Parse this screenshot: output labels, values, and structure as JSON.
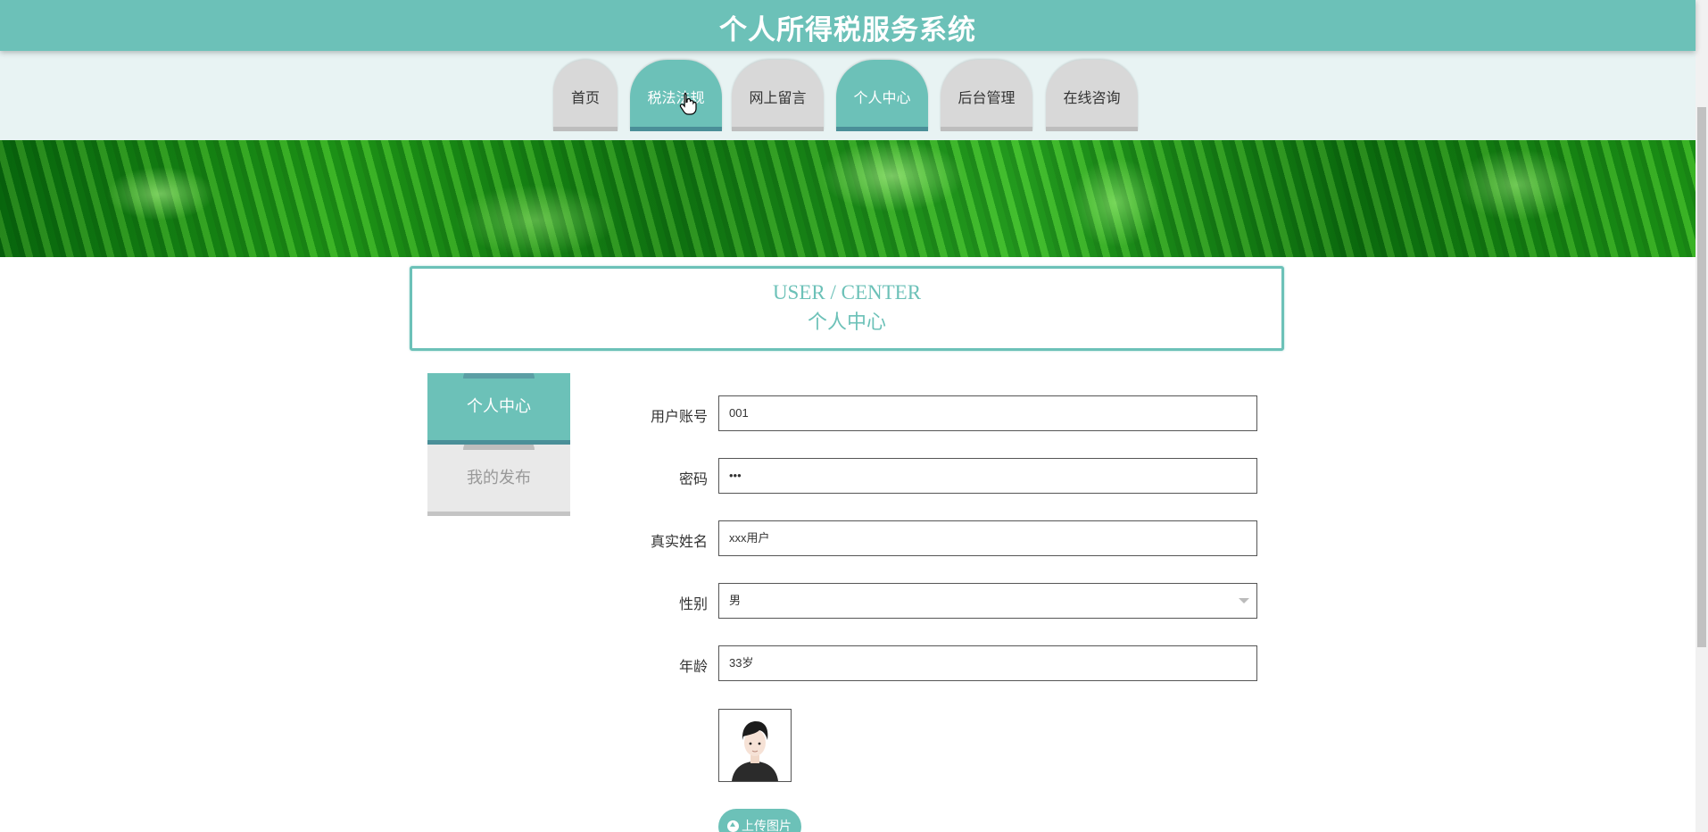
{
  "header": {
    "title": "个人所得税服务系统"
  },
  "nav": {
    "items": [
      {
        "label": "首页",
        "active": false
      },
      {
        "label": "税法法规",
        "active": true
      },
      {
        "label": "网上留言",
        "active": false
      },
      {
        "label": "个人中心",
        "active": true
      },
      {
        "label": "后台管理",
        "active": false
      },
      {
        "label": "在线咨询",
        "active": false
      }
    ]
  },
  "section": {
    "title_en": "USER / CENTER",
    "title_cn": "个人中心"
  },
  "side_menu": {
    "items": [
      {
        "label": "个人中心",
        "active": true
      },
      {
        "label": "我的发布",
        "active": false
      }
    ]
  },
  "form": {
    "account_label": "用户账号",
    "account_value": "001",
    "password_label": "密码",
    "password_value": "•••",
    "realname_label": "真实姓名",
    "realname_value": "xxx用户",
    "gender_label": "性别",
    "gender_value": "男",
    "age_label": "年龄",
    "age_value": "33岁",
    "upload_label": "上传图片"
  },
  "colors": {
    "accent": "#6cc1b8",
    "accent_dark": "#4a8f98",
    "inactive_tab": "#d8d8d8"
  },
  "icons": {
    "cursor": "hand-pointer-icon",
    "upload": "upload-icon",
    "select": "chevron-down-icon"
  }
}
